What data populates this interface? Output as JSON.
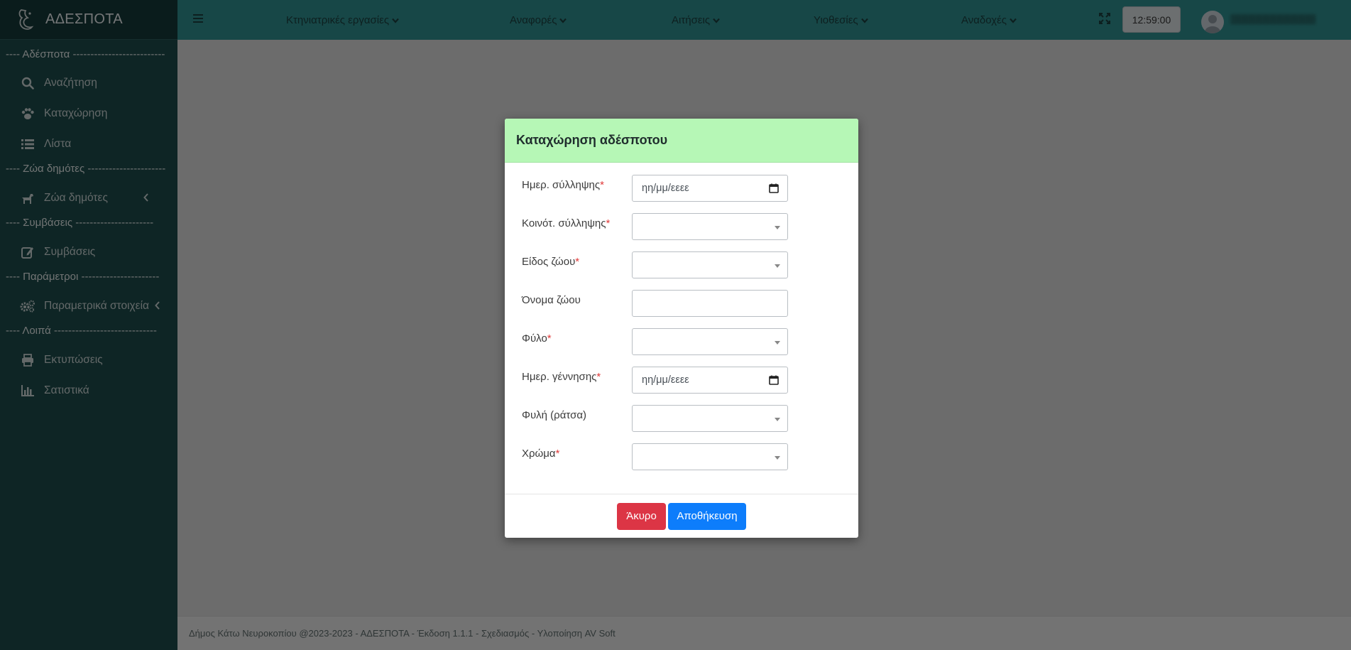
{
  "app": {
    "brand": "ΑΔΕΣΠΟΤΑ"
  },
  "sidebar": {
    "sections": [
      {
        "header": "---- Αδέσποτα --------------------------"
      },
      {
        "header": "---- Ζώα δημότες ----------------------"
      },
      {
        "header": "---- Συμβάσεις ----------------------"
      },
      {
        "header": "---- Παράμετροι ----------------------"
      },
      {
        "header": "---- Λοιπά -----------------------------"
      }
    ],
    "items": [
      {
        "label": "Αναζήτηση",
        "icon": "search-icon"
      },
      {
        "label": "Καταχώρηση",
        "icon": "paw-icon"
      },
      {
        "label": "Λίστα",
        "icon": "list-icon"
      },
      {
        "label": "Ζώα δημότες",
        "icon": "dog-icon"
      },
      {
        "label": "Συμβάσεις",
        "icon": "edit-icon"
      },
      {
        "label": "Παραμετρικά στοιχεία",
        "icon": "gears-icon"
      },
      {
        "label": "Εκτυπώσεις",
        "icon": "print-icon"
      },
      {
        "label": "Σατιστικά",
        "icon": "bar-chart-icon"
      }
    ]
  },
  "topbar": {
    "menus": [
      {
        "label": "Κτηνιατρικές εργασίες"
      },
      {
        "label": "Αναφορές"
      },
      {
        "label": "Αιτήσεις"
      },
      {
        "label": "Υιοθεσίες"
      },
      {
        "label": "Αναδοχές"
      }
    ],
    "clock": "12:59:00",
    "username": "████████████"
  },
  "modal": {
    "title": "Καταχώρηση αδέσποτου",
    "fields": [
      {
        "label": "Ημερ. σύλληψης",
        "required": "*",
        "type": "date",
        "placeholder": "ηη/μμ/εεεε"
      },
      {
        "label": "Κοινότ. σύλληψης",
        "required": "*",
        "type": "select",
        "value": ""
      },
      {
        "label": "Είδος ζώου",
        "required": "*",
        "type": "select",
        "value": ""
      },
      {
        "label": "Όνομα ζώου",
        "required": "",
        "type": "text",
        "value": ""
      },
      {
        "label": "Φύλο",
        "required": "*",
        "type": "select",
        "value": ""
      },
      {
        "label": "Ημερ. γέννησης",
        "required": "*",
        "type": "date",
        "placeholder": "ηη/μμ/εεεε"
      },
      {
        "label": "Φυλή (ράτσα)",
        "required": "",
        "type": "select",
        "value": ""
      },
      {
        "label": "Χρώμα",
        "required": "*",
        "type": "select",
        "value": ""
      }
    ],
    "cancel_label": "Άκυρο",
    "save_label": "Αποθήκευση"
  },
  "footer": {
    "text": "Δήμος Κάτω Νευροκοπίου @2023-2023 - ΑΔΕΣΠΟΤΑ - Έκδοση 1.1.1 - Σχεδιασμός - Υλοποίηση AV Soft"
  },
  "colors": {
    "sidebar": "#1c4b4b",
    "topbar": "#2f8f8f",
    "modal_header": "#b6f7b6",
    "cancel": "#dc3545",
    "save": "#0d7dfb"
  }
}
